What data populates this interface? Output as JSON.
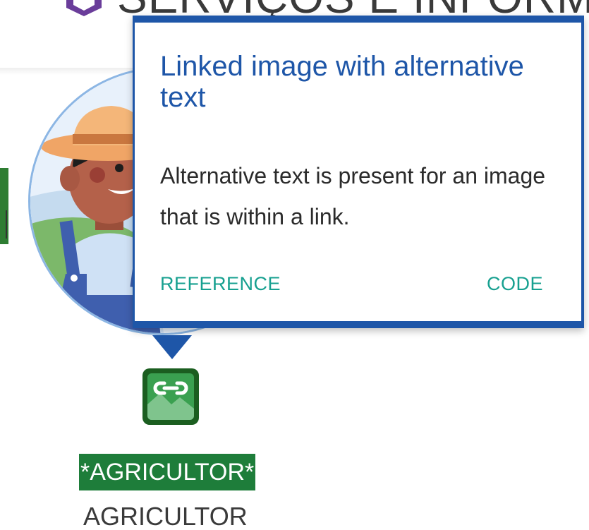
{
  "page": {
    "heading_text": "SERVIÇOS E INFORMAÇÕES",
    "heading_icon": "cube-icon"
  },
  "popup": {
    "title": "Linked image with alternative text",
    "description": "Alternative text is present for an image that is within a link.",
    "reference_label": "REFERENCE",
    "code_label": "CODE",
    "accent_color": "#1e56a8",
    "link_color": "#17a090"
  },
  "badge": {
    "icon": "linked-image-icon",
    "color": "#1b5e20"
  },
  "card": {
    "alt_text_label": "*AGRICULTOR*",
    "caption": "AGRICULTOR",
    "avatar_icon": "farmer-avatar"
  }
}
